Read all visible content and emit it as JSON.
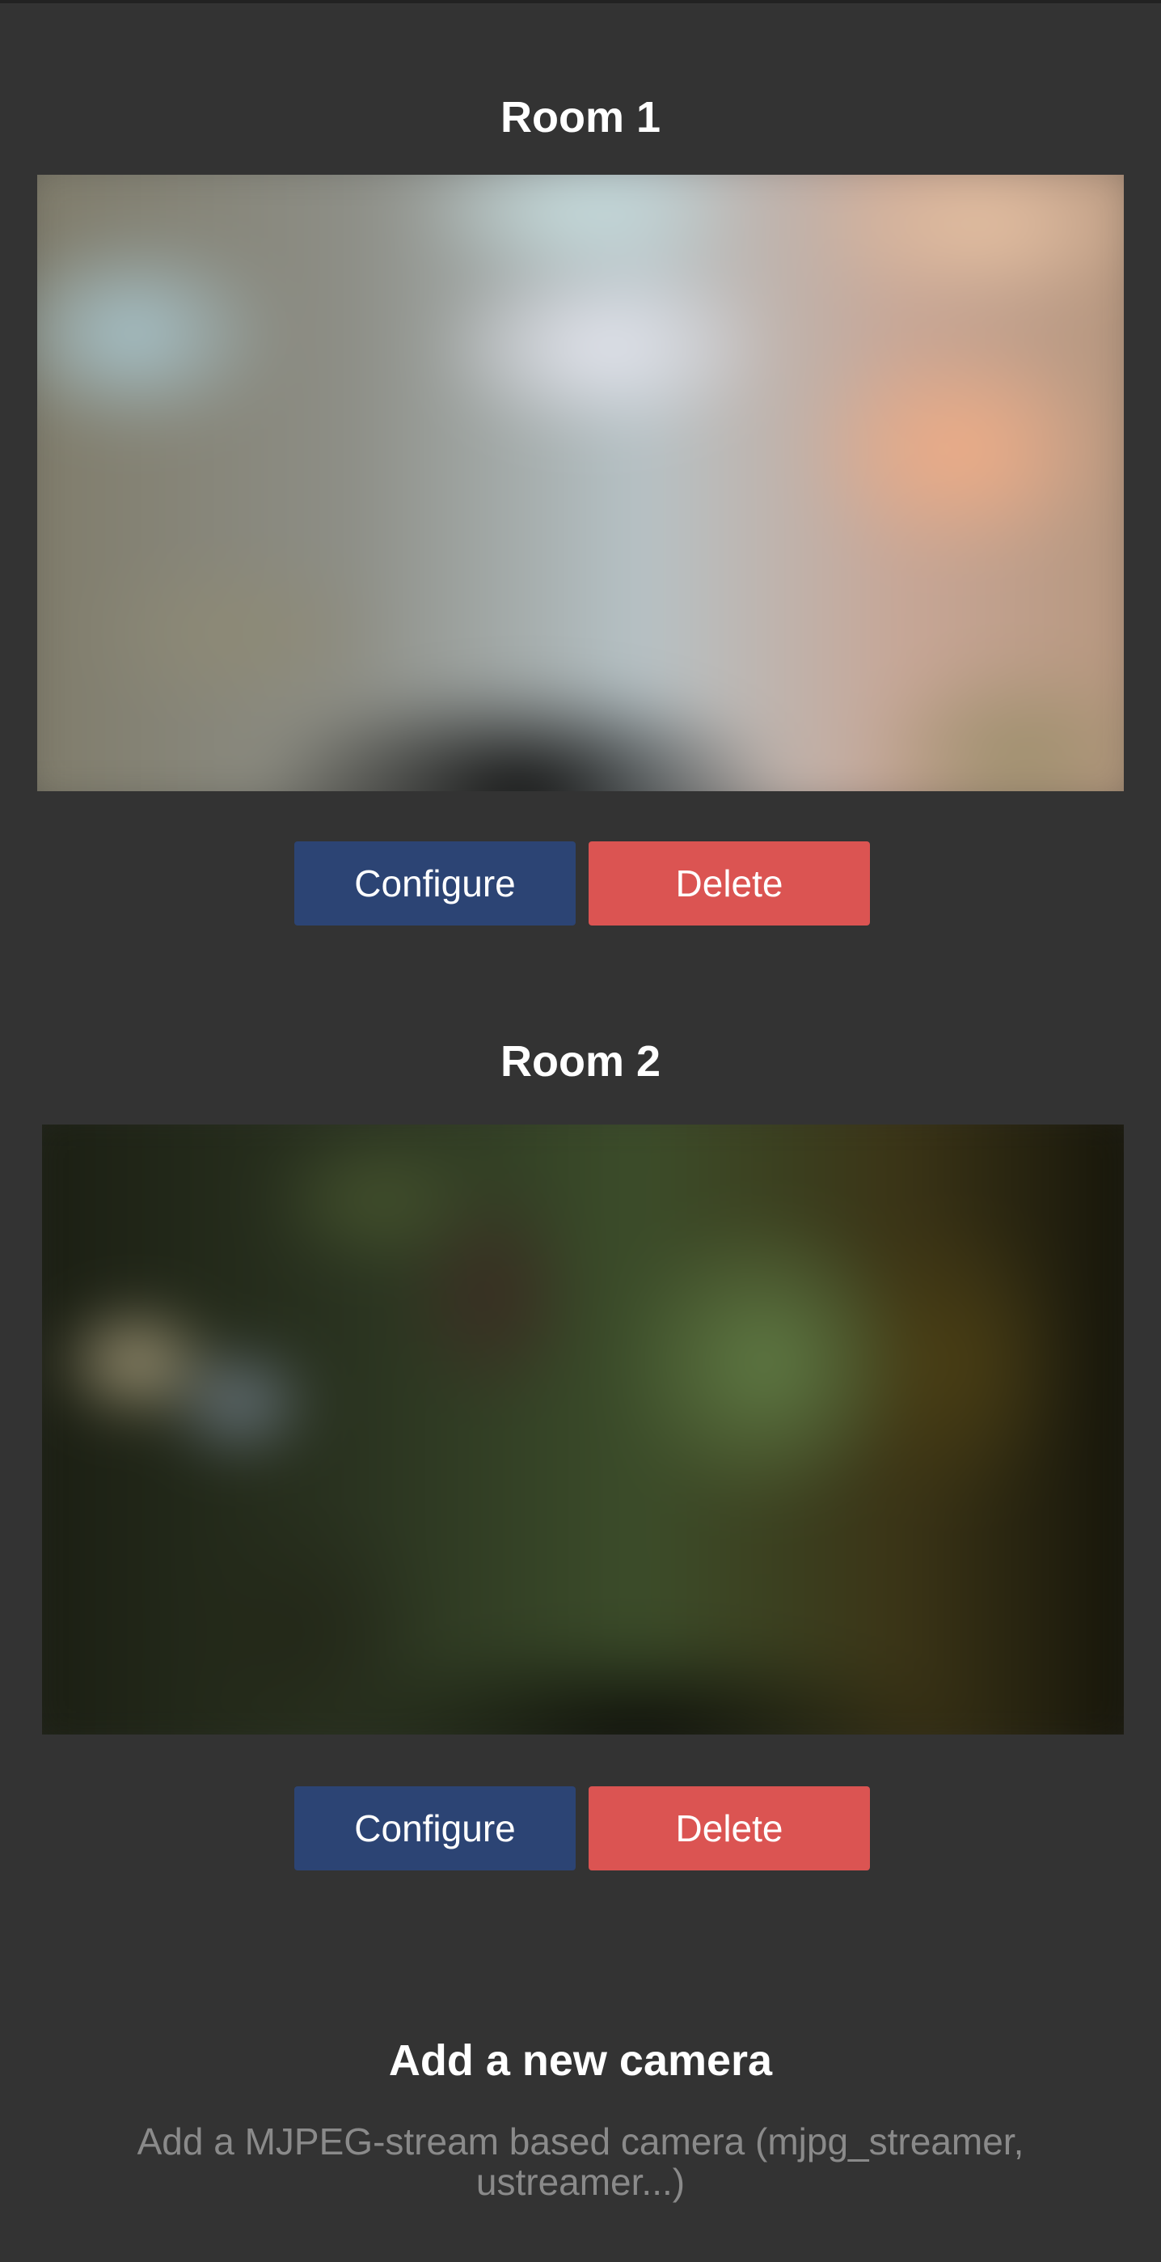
{
  "cameras": [
    {
      "title": "Room 1",
      "configure_label": "Configure",
      "delete_label": "Delete"
    },
    {
      "title": "Room 2",
      "configure_label": "Configure",
      "delete_label": "Delete"
    }
  ],
  "add_camera": {
    "title": "Add a new camera",
    "description": "Add a MJPEG-stream based camera (mjpg_streamer, ustreamer...)"
  },
  "colors": {
    "background": "#333333",
    "configure_button": "#2c4474",
    "delete_button": "#db5452",
    "description_text": "#8a8a8a"
  }
}
